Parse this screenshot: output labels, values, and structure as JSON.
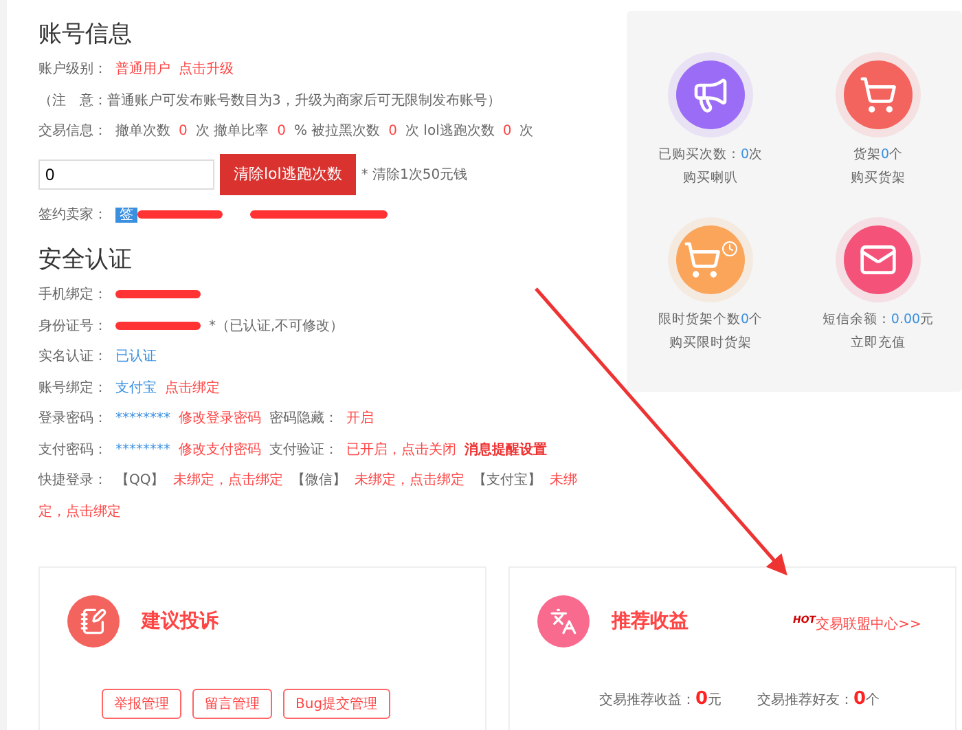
{
  "account": {
    "title": "账号信息",
    "rows": [
      {
        "segments": [
          {
            "text": "账户级别：",
            "kind": "label"
          },
          {
            "text": "普通用户",
            "kind": "red"
          },
          {
            "text": "点击升级",
            "kind": "red"
          }
        ]
      },
      {
        "segments": [
          {
            "text": "（注　意：普通账户可发布账号数目为3，升级为商家后可无限制发布账号）",
            "kind": "label"
          }
        ]
      },
      {
        "segments": [
          {
            "text": "交易信息：",
            "kind": "label"
          },
          {
            "text": "撤单次数",
            "kind": "label"
          },
          {
            "text": "0",
            "kind": "red"
          },
          {
            "text": "次 撤单比率",
            "kind": "label"
          },
          {
            "text": "0",
            "kind": "red"
          },
          {
            "text": "% 被拉黑次数",
            "kind": "label"
          },
          {
            "text": "0",
            "kind": "red"
          },
          {
            "text": "次 lol逃跑次数",
            "kind": "label"
          },
          {
            "text": "0",
            "kind": "red"
          },
          {
            "text": "次",
            "kind": "label"
          }
        ]
      }
    ],
    "clear": {
      "value": "0",
      "button": "清除lol逃跑次数",
      "note": "* 清除1次50元钱"
    },
    "seller": {
      "label": "签约卖家：",
      "badge": "签"
    }
  },
  "security": {
    "title": "安全认证",
    "rows": [
      {
        "segments": [
          {
            "text": "手机绑定：",
            "kind": "label"
          },
          {
            "kind": "redacted"
          }
        ]
      },
      {
        "segments": [
          {
            "text": "身份证号：",
            "kind": "label"
          },
          {
            "kind": "redacted"
          },
          {
            "text": "*（已认证,不可修改）",
            "kind": "label"
          }
        ]
      },
      {
        "segments": [
          {
            "text": "实名认证：",
            "kind": "label"
          },
          {
            "text": "已认证",
            "kind": "blue"
          }
        ]
      },
      {
        "segments": [
          {
            "text": "账号绑定：",
            "kind": "label"
          },
          {
            "text": "支付宝",
            "kind": "blue"
          },
          {
            "text": "点击绑定",
            "kind": "red"
          }
        ]
      },
      {
        "segments": [
          {
            "text": "登录密码：",
            "kind": "label"
          },
          {
            "text": "********",
            "kind": "blue"
          },
          {
            "text": "修改登录密码",
            "kind": "red"
          },
          {
            "text": "密码隐藏：",
            "kind": "label"
          },
          {
            "text": "开启",
            "kind": "red"
          }
        ]
      },
      {
        "segments": [
          {
            "text": "支付密码：",
            "kind": "label"
          },
          {
            "text": "********",
            "kind": "blue"
          },
          {
            "text": "修改支付密码",
            "kind": "red"
          },
          {
            "text": "支付验证：",
            "kind": "label"
          },
          {
            "text": "已开启，点击关闭",
            "kind": "red"
          },
          {
            "text": "消息提醒设置",
            "kind": "strong"
          }
        ]
      },
      {
        "segments": [
          {
            "text": "快捷登录：",
            "kind": "label"
          },
          {
            "text": "【QQ】",
            "kind": "label"
          },
          {
            "text": "未绑定，点击绑定",
            "kind": "red"
          },
          {
            "text": "【微信】",
            "kind": "label"
          },
          {
            "text": "未绑定，点击绑定",
            "kind": "red"
          },
          {
            "text": "【支付宝】",
            "kind": "label"
          },
          {
            "text": "未绑",
            "kind": "red"
          },
          {
            "text": "定，点击绑定",
            "kind": "red"
          }
        ]
      }
    ]
  },
  "services": [
    {
      "kind": "megaphone",
      "color": "#9b6cf5",
      "lines": [
        [
          {
            "text": "已购买次数："
          },
          {
            "text": "0",
            "accent": true
          },
          {
            "text": "次"
          }
        ],
        [
          {
            "text": "购买喇叭"
          }
        ]
      ]
    },
    {
      "kind": "cart",
      "color": "#f4645f",
      "lines": [
        [
          {
            "text": "货架"
          },
          {
            "text": "0",
            "accent": true
          },
          {
            "text": "个"
          }
        ],
        [
          {
            "text": "购买货架"
          }
        ]
      ]
    },
    {
      "kind": "timed-cart",
      "color": "#fba55a",
      "lines": [
        [
          {
            "text": "限时货架个数"
          },
          {
            "text": "0",
            "accent": true
          },
          {
            "text": "个"
          }
        ],
        [
          {
            "text": "购买限时货架"
          }
        ]
      ]
    },
    {
      "kind": "envelope",
      "color": "#f5527a",
      "lines": [
        [
          {
            "text": "短信余额："
          },
          {
            "text": "0.00",
            "accent": true
          },
          {
            "text": "元"
          }
        ],
        [
          {
            "text": "立即充值"
          }
        ]
      ]
    }
  ],
  "complaints": {
    "title": "建议投诉",
    "buttons": [
      "举报管理",
      "留言管理",
      "Bug提交管理"
    ]
  },
  "referral": {
    "title": "推荐收益",
    "badge": "HOT",
    "link": "交易联盟中心>>",
    "stats": [
      {
        "label": "交易推荐收益：",
        "value": "0",
        "unit": "元"
      },
      {
        "label": "交易推荐好友：",
        "value": "0",
        "unit": "个"
      }
    ]
  }
}
